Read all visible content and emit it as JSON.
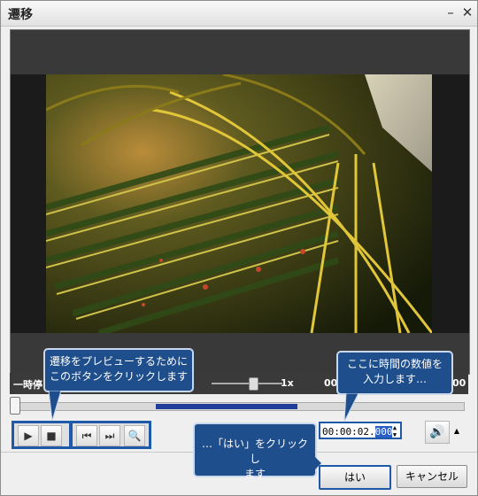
{
  "window": {
    "title": "遷移"
  },
  "titlebar": {
    "minimize_glyph": "–",
    "close_glyph": "✕"
  },
  "controls": {
    "speed_label": "1x",
    "left_label": "一時停",
    "time_left_fragment": "00",
    "time_right_fragment": "00",
    "buttons": {
      "play": "▶",
      "stop": "■",
      "prev": "⏮",
      "next": "⏭",
      "zoom": "🔍"
    }
  },
  "time_field": {
    "value_prefix": "00:00:02.",
    "value_selected": "000",
    "spin_up": "▲",
    "spin_down": "▼"
  },
  "volume": {
    "icon": "🔊",
    "arrow": "▲"
  },
  "footer": {
    "ok_label": "はい",
    "cancel_label": "キャンセル"
  },
  "callouts": {
    "preview": "遷移をプレビューするために\nこのボタンをクリックします",
    "time": "ここに時間の数値を\n入力します…",
    "ok": "…「はい」をクリックし\nます"
  },
  "colors": {
    "accent": "#1f5aa8",
    "callout_bg": "#1f4e8c",
    "seek_fill": "#1f3d99"
  },
  "icons": {
    "play": "play-icon",
    "stop": "stop-icon",
    "prev": "skip-back-icon",
    "next": "skip-forward-icon",
    "zoom": "zoom-icon",
    "volume": "speaker-icon"
  }
}
